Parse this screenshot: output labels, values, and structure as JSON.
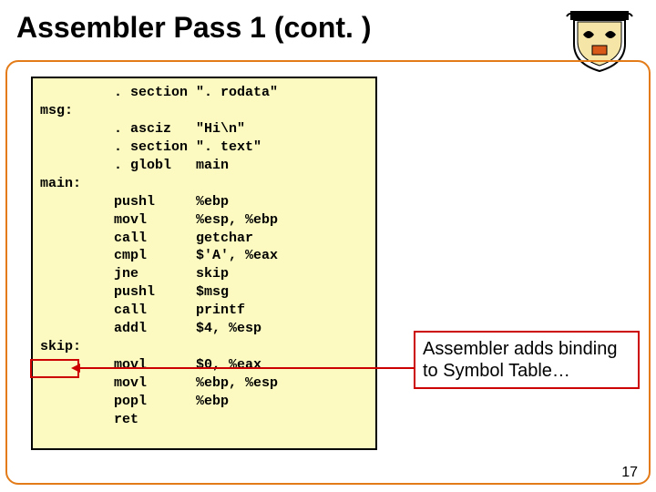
{
  "title": "Assembler Pass 1 (cont. )",
  "code": {
    "lines": [
      "         . section \". rodata\"",
      "msg:",
      "         . asciz   \"Hi\\n\"",
      "         . section \". text\"",
      "         . globl   main",
      "main:",
      "         pushl     %ebp",
      "         movl      %esp, %ebp",
      "         call      getchar",
      "         cmpl      $'A', %eax",
      "         jne       skip",
      "         pushl     $msg",
      "         call      printf",
      "         addl      $4, %esp",
      "skip:",
      "         movl      $0, %eax",
      "         movl      %ebp, %esp",
      "         popl      %ebp",
      "         ret"
    ]
  },
  "annotation": "Assembler adds binding to Symbol Table…",
  "page_number": "17",
  "crest_alt": "university-crest"
}
